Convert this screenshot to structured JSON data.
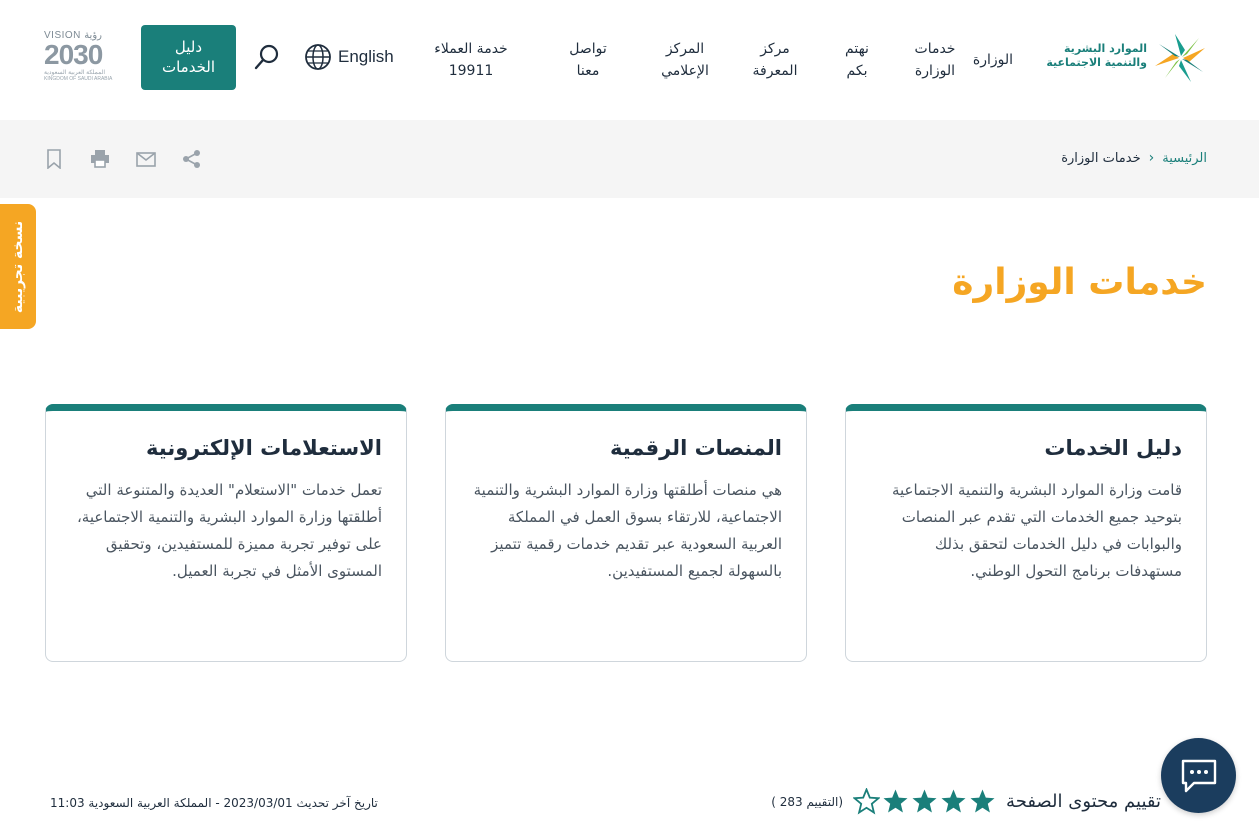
{
  "header": {
    "logo_text_line1": "الموارد البشرية",
    "logo_text_line2": "والتنمية الاجتماعية",
    "nav": [
      {
        "line1": "الوزارة",
        "line2": ""
      },
      {
        "line1": "خدمات",
        "line2": "الوزارة"
      },
      {
        "line1": "نهتم",
        "line2": "بكم"
      },
      {
        "line1": "مركز",
        "line2": "المعرفة"
      },
      {
        "line1": "المركز",
        "line2": "الإعلامي"
      },
      {
        "line1": "تواصل",
        "line2": "معنا"
      },
      {
        "line1": "خدمة العملاء",
        "line2": "19911"
      }
    ],
    "language_label": "English",
    "guide_button_line1": "دليل",
    "guide_button_line2": "الخدمات",
    "vision_top": "VISION رؤية",
    "vision_number": "2030",
    "vision_arabic": "المملكة العربية السعودية",
    "vision_bottom": "KINGDOM OF SAUDI ARABIA"
  },
  "breadcrumb": {
    "home": "الرئيسية",
    "current": "خدمات الوزارة"
  },
  "beta_tab": "نسخة تجريبية",
  "page_title": "خدمات الوزارة",
  "cards": [
    {
      "title": "دليل الخدمات",
      "body": "قامت وزارة الموارد البشرية والتنمية الاجتماعية بتوحيد جميع الخدمات التي تقدم عبر المنصات والبوابات في دليل الخدمات لتحقق بذلك مستهدفات برنامج التحول الوطني."
    },
    {
      "title": "المنصات الرقمية",
      "body": "هي منصات أطلقتها وزارة الموارد البشرية والتنمية الاجتماعية، للارتقاء بسوق العمل في المملكة العربية السعودية عبر تقديم خدمات رقمية تتميز بالسهولة لجميع المستفيدين."
    },
    {
      "title": "الاستعلامات الإلكترونية",
      "body": "تعمل خدمات \"الاستعلام\" العديدة والمتنوعة التي أطلقتها وزارة الموارد البشرية والتنمية الاجتماعية، على توفير تجربة مميزة للمستفيدين، وتحقيق المستوى الأمثل في تجربة العميل."
    }
  ],
  "rating": {
    "label": "تقييم محتوى الصفحة",
    "value": 4,
    "max": 5,
    "count_text": "(التقييم 283 )"
  },
  "last_updated": "تاريخ آخر تحديث 2023/03/01 - المملكة العربية السعودية 11:03",
  "colors": {
    "teal": "#1a7f7a",
    "orange": "#f5a623",
    "navy": "#1b3d5e"
  },
  "icons": [
    "globe-icon",
    "search-icon",
    "share-icon",
    "mail-icon",
    "print-icon",
    "bookmark-icon",
    "star-icon",
    "chat-icon"
  ]
}
